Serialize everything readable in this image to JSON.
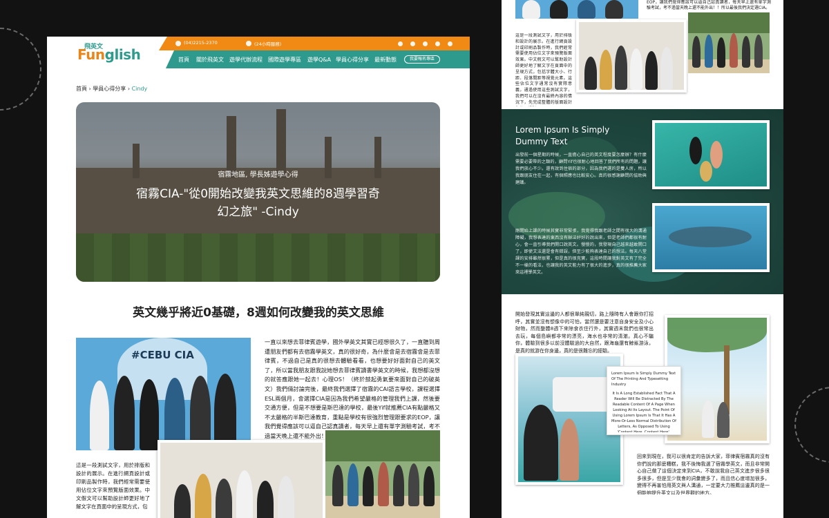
{
  "left_page": {
    "logo": {
      "small": "飛英文",
      "main_orange": "Fun",
      "main_teal": "glish"
    },
    "topbar": {
      "phone": "(04)2215-2370",
      "hours": "(24小時服務)"
    },
    "nav": [
      "首頁",
      "關於飛英文",
      "遊學代辦流程",
      "國際遊學專區",
      "遊學Q&A",
      "學員心得分享",
      "最新動態"
    ],
    "nav_button": "我要報名專區",
    "breadcrumb": {
      "home": "首頁",
      "sep1": "›",
      "section": "學員心得分享",
      "sep2": "›",
      "current": "Cindy"
    },
    "hero": {
      "subtitle": "宿霧地區, 學長姊遊學心得",
      "title": "宿霧CIA-\"從0開始改變我英文思維的8週學習奇幻之旅\" -Cindy"
    },
    "heading": "英文幾乎將近0基礎，8週如何改變我的英文思維",
    "photo_sign": "#CEBU CIA",
    "body_main": "一直以來想去菲律賓遊學，國外學英文其實已經想很久了，一直聽到周遭朋友們都有去宿霧學英文，真的很好奇，為什麼會是去宿霧會是去菲律賓，不過自己是真的很想去體驗看看，也想要好好面對自己的英文了，所以當我朋友跟我說她想去菲律賓讀書學英文的時候，我想都沒想的就答應跟她一起去！心理OS！（終於鼓起勇氣要來面對自己的破英文）我們倆討論完後，最終我們選擇了宿霧的CAI語言學校，課程選擇ESL兩個月，會選擇CIA是因為我們希望嚴格的管理我們上課，然後要交通方便，但是不想要是斯巴達的學校，最後Yif就推薦CIA有點嚴格又不太嚴格的半斯巴達教育，重點是學校有很強烈管理跟要求的EOP，讓我們覺得應該可以逼自己認真讀者，每天早上還有單字測驗考試，考不過當天晚上還不能外出！！所以最後我們決定選CIA。",
    "body_small": "這是一段測試文字，用於排版和設計的展示。在進行網頁設計或印刷品製作時，我們經常需要使用佔位文字來預覽版面效果。中文假文可以幫助設計師更好地了解文字在頁面中的呈現方式，包"
  },
  "right_page": {
    "top_text": "EOP，讓我們覺得應該可以逼自己認真讀者，每天早上還有單字測驗考試，考不過當天晚上還不能外出！！所以最後我們決定選CIA。",
    "left_col_text": "這是一段測試文字，用於排版和設計的展示。在進行網頁設計或印刷品製作時，我們經常需要使用佔位文字來預覽版面效果。中文假文可以幫助設計師更好地了解文字在頁面中的呈現方式，包括字體大小、行距、段落間距等視覺元素。這些佔位文字通常沒有實際意義，通過使用這些測試文字，我們可以在沒有最終內容的情況下，先完成整體的版面設計和佈局規劃。",
    "lorem_title": "Lorem Ipsum Is Simply Dummy Text",
    "ocean_para1": "出發前一個星期的時候，一直擔心自己的英文程度要怎麼辦？有什麼需要必要帶的之類的，顧問Yif也很耐心地回答了我們所有的問題，讓我們放心不少。還有說到住宿的部分，因為我們選的是雙人房，所以我跟朋友住在一起，有個照應也比較安心。真的很感謝顧問的協助與建議。",
    "ocean_para2": "剛開始上課的時候其實非常緊張，我覺得我跟老師之間有很大的溝通障礙，我想表達的東西沒有辦法好好的說出來，但是老師們都很有耐心，會一直引導我們開口說英文。慢慢的，我發現自己越來越敢開口了，即使文法還是會有錯誤，但至少能夠表達自己的想法。每天八堂課的安排雖然很累，但是真的很充實，這段時間讓我對英文有了完全不一樣的看法，也讓我的英文能力有了很大的進步，真的很推薦大家來這裡學英文。",
    "para3": "開始發現其實這邊的人都很單純親切，路上隨時有人會跟你打招呼，其實並沒有想像中的可怕，當然還是要注意自身安全及小心財物，然而整體8週下來除食衣住行外，其實週末我們也很常出去玩，每個島嶼都非常的漂亮，海水也非常的清澈。真心不騙你，體驗到很多以前沒體驗過的大自然，跟海龜還有鯨鯊游泳，是真的就游在你身邊，真的是很難忘的經驗。",
    "quote_title": "Lorem Ipsum Is Simply Dummy Text Of The Printing And Typesetting Industry",
    "quote_body": "It Is A Long Established Fact That A Reader Will Be Distracted By The Readable Content Of A Page When Looking At Its Layout. The Point Of Using Lorem Ipsum Is That It Has A More-Or-Less Normal Distribution Of Letters, As Opposed To Using 'Content Here, Content Here', Making It Look Like Readable English. Many Desktop Publishing Packages And Web Page Editors Now Use Lorem Ipsum As Their Default Model Text.",
    "para4": "回來到現在，我可以很肯定的告訴大家，菲律賓宿霧真的沒有你們說的那麼糟糕，我不後悔我選了宿霧學英文，而且非常開心自己做了這個決定來到CIA，不敢說我自己英文進步很多很多很多，但是至少我會的詞彙變多了，而且信心度增加很多，變得不再害怕用英文與人溝通，一定要大力推薦這邊真的是一個能夠提升英文以及世界觀的地方。"
  },
  "colors": {
    "orange": "#f08a14",
    "teal": "#2e9a8d",
    "background": "#121212"
  },
  "icons": [
    "phone-icon",
    "clock-icon",
    "line-icon",
    "mail-icon",
    "facebook-icon",
    "instagram-icon",
    "youtube-icon"
  ]
}
